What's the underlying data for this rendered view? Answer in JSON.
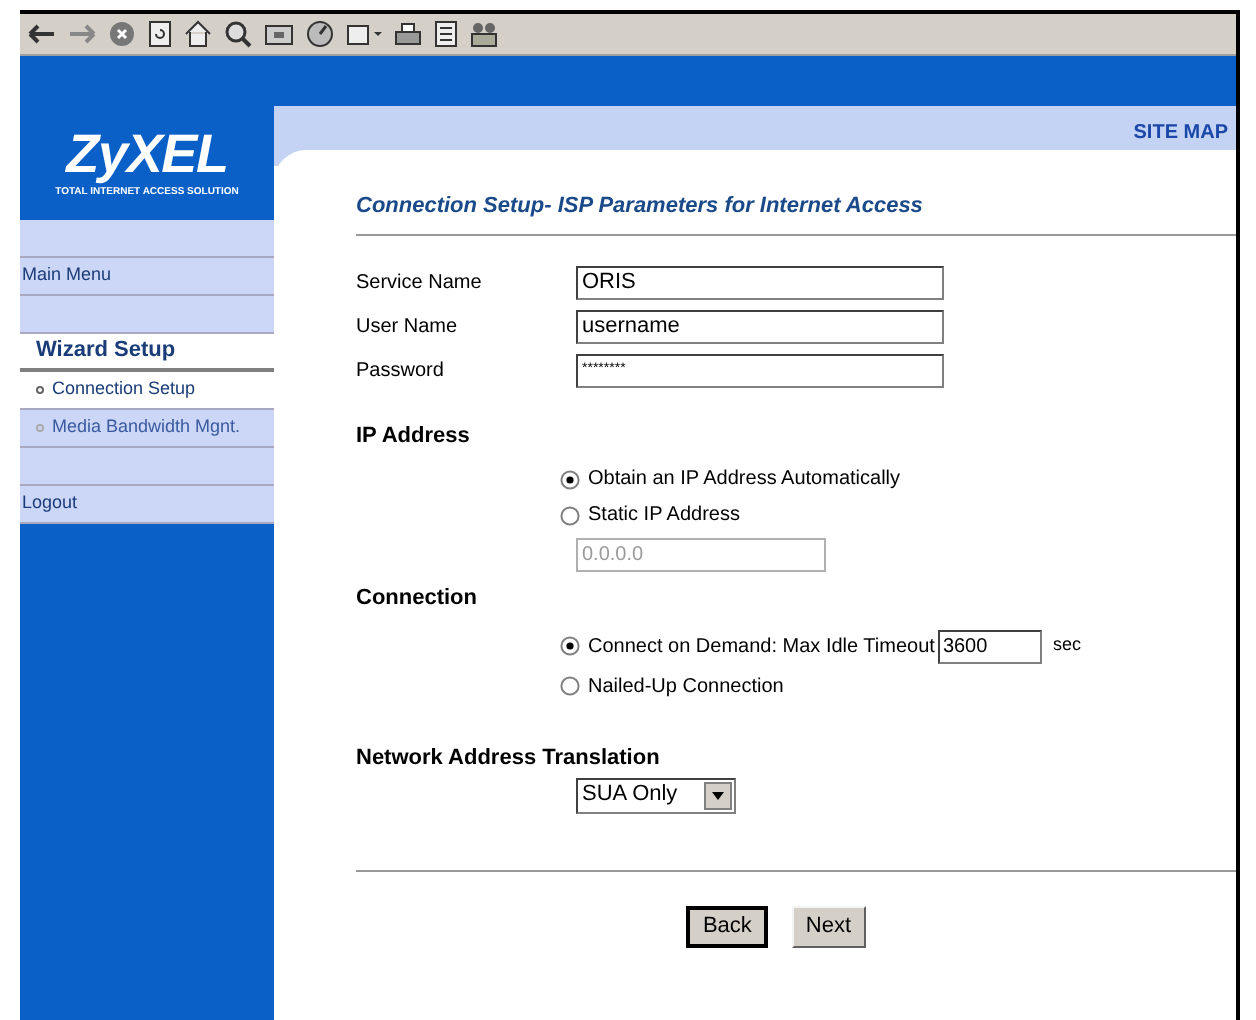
{
  "sidebar": {
    "logo": {
      "name": "ZyXEL",
      "tagline": "TOTAL INTERNET ACCESS SOLUTION"
    },
    "items": [
      {
        "kind": "spacer"
      },
      {
        "kind": "link",
        "label": "Main Menu"
      },
      {
        "kind": "spacer"
      },
      {
        "kind": "section",
        "label": "Wizard Setup"
      },
      {
        "kind": "sublink",
        "label": "Connection Setup",
        "selected": true
      },
      {
        "kind": "sublink",
        "label": "Media Bandwidth Mgnt.",
        "selected": false
      },
      {
        "kind": "spacer"
      },
      {
        "kind": "link",
        "label": "Logout"
      }
    ]
  },
  "header": {
    "site_map": "SITE MAP"
  },
  "form": {
    "title": "Connection Setup- ISP Parameters for Internet Access",
    "fields": [
      {
        "label": "Service Name",
        "value": "ORIS",
        "kind": "text"
      },
      {
        "label": "User Name",
        "value": "username",
        "kind": "text"
      },
      {
        "label": "Password",
        "value": "********",
        "kind": "password"
      }
    ],
    "ip_address": {
      "title": "IP Address",
      "options": [
        {
          "label": "Obtain an IP Address Automatically",
          "selected": true
        },
        {
          "label": "Static IP Address",
          "selected": false
        }
      ],
      "static_ip": {
        "value": "0.0.0.0",
        "disabled": true
      }
    },
    "connection": {
      "title": "Connection",
      "options": [
        {
          "label": "Connect on Demand: Max Idle Timeout",
          "selected": true,
          "timeout": "3600",
          "unit": "sec"
        },
        {
          "label": "Nailed-Up Connection",
          "selected": false
        }
      ]
    },
    "nat": {
      "title": "Network Address Translation",
      "value": "SUA Only"
    },
    "buttons": [
      {
        "label": "Back",
        "focused": true
      },
      {
        "label": "Next",
        "focused": false
      }
    ]
  }
}
